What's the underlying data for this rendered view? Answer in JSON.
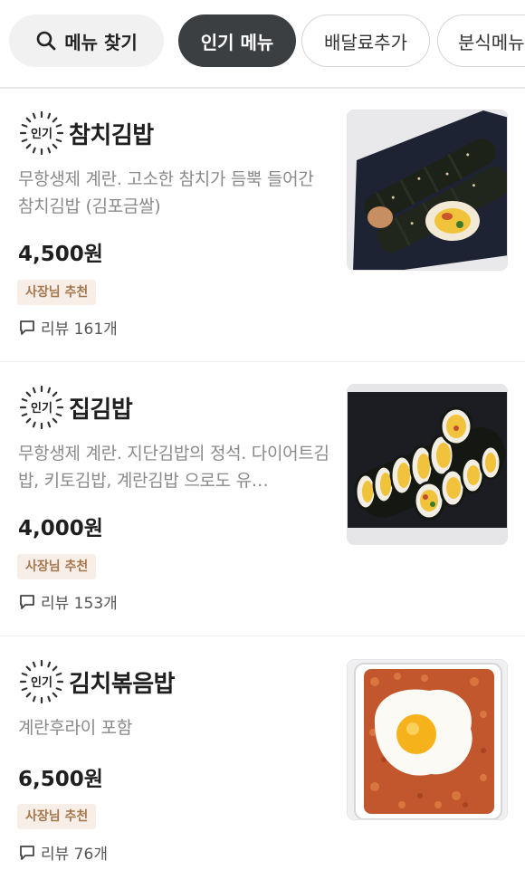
{
  "chips": [
    {
      "label": "메뉴 찾기",
      "icon": "search-icon"
    },
    {
      "label": "인기 메뉴",
      "active": true
    },
    {
      "label": "배달료추가"
    },
    {
      "label": "분식메뉴"
    }
  ],
  "badge_text": "인기",
  "review_icon": "chat-bubble-icon",
  "items": [
    {
      "name": "참치김밥",
      "description": "무항생제 계란. 고소한 참치가 듬뿍 들어간 참치김밥 (김포금쌀)",
      "price": "4,500원",
      "tag": "사장님 추천",
      "reviews": "리뷰 161개"
    },
    {
      "name": "집김밥",
      "description": "무항생제 계란. 지단김밥의 정석. 다이어트김밥, 키토김밥, 계란김밥 으로도 유…",
      "price": "4,000원",
      "tag": "사장님 추천",
      "reviews": "리뷰 153개"
    },
    {
      "name": "김치볶음밥",
      "description": "계란후라이 포함",
      "price": "6,500원",
      "tag": "사장님 추천",
      "reviews": "리뷰 76개"
    }
  ],
  "colors": {
    "active_chip_bg": "#3b3f42",
    "tag_bg": "#f6eee7",
    "tag_text": "#a5774e",
    "description_text": "#8a8a8a"
  }
}
